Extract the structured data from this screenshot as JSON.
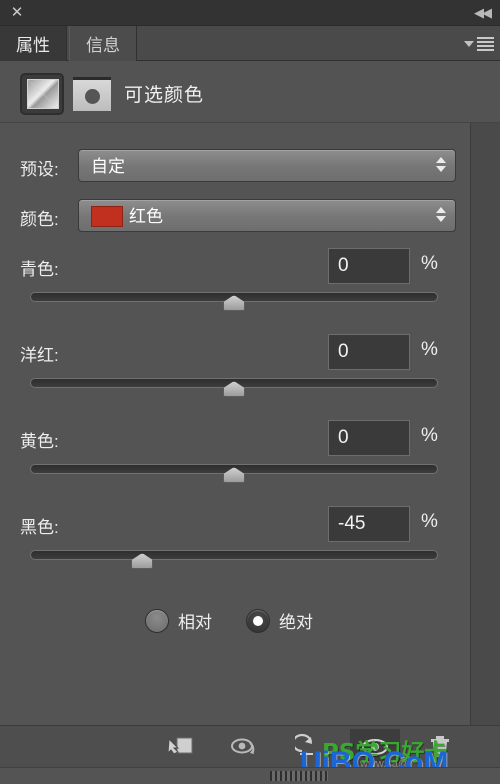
{
  "window": {
    "close_label": "✕",
    "collapse_label": "◀◀"
  },
  "tabs": [
    {
      "label": "属性",
      "active": true
    },
    {
      "label": "信息",
      "active": false
    }
  ],
  "panel_menu": {
    "icon": "panel-menu-icon"
  },
  "adjustment": {
    "icon": "selective-color-icon",
    "mask_icon": "layer-mask-thumbnail",
    "title": "可选颜色"
  },
  "preset": {
    "label": "预设:",
    "value": "自定"
  },
  "colors_select": {
    "label": "颜色:",
    "value": "红色",
    "swatch_hex": "#c1301f"
  },
  "sliders": [
    {
      "label": "青色:",
      "value": "0",
      "unit": "%",
      "percent": 50.0
    },
    {
      "label": "洋红:",
      "value": "0",
      "unit": "%",
      "percent": 50.0
    },
    {
      "label": "黄色:",
      "value": "0",
      "unit": "%",
      "percent": 50.0
    },
    {
      "label": "黑色:",
      "value": "-45",
      "unit": "%",
      "percent": 27.5
    }
  ],
  "method": {
    "options": [
      {
        "label": "相对",
        "selected": false
      },
      {
        "label": "绝对",
        "selected": true
      }
    ]
  },
  "footer": {
    "buttons": [
      {
        "name": "clip-to-layer-icon",
        "selected": false
      },
      {
        "name": "preview-previous-icon",
        "selected": false
      },
      {
        "name": "reset-icon",
        "selected": false
      },
      {
        "name": "toggle-visibility-icon",
        "selected": true
      },
      {
        "name": "delete-icon",
        "selected": false
      }
    ]
  },
  "watermark": {
    "green_text": "PS学习好卡",
    "blue_text": "UiBQ.CoM",
    "sub_text": "www.sa@"
  }
}
